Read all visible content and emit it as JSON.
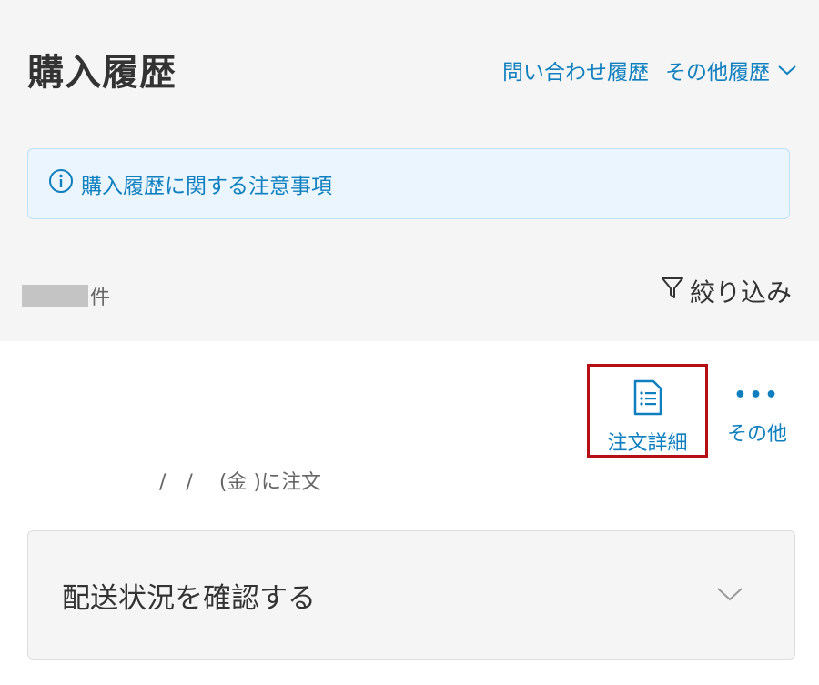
{
  "header": {
    "title": "購入履歴",
    "inquiry_link": "問い合わせ履歴",
    "other_history_link": "その他履歴"
  },
  "notice": {
    "text": "購入履歴に関する注意事項"
  },
  "list": {
    "count_suffix": "件",
    "filter_label": "絞り込み"
  },
  "order": {
    "detail_label": "注文詳細",
    "other_label": "その他",
    "other_dots": "•••",
    "date_text": "/　/　 (金 )に注文"
  },
  "delivery": {
    "label": "配送状況を確認する"
  },
  "colors": {
    "link": "#0f7fbf",
    "highlight_border": "#b50e14",
    "notice_bg": "#eaf5fd"
  }
}
